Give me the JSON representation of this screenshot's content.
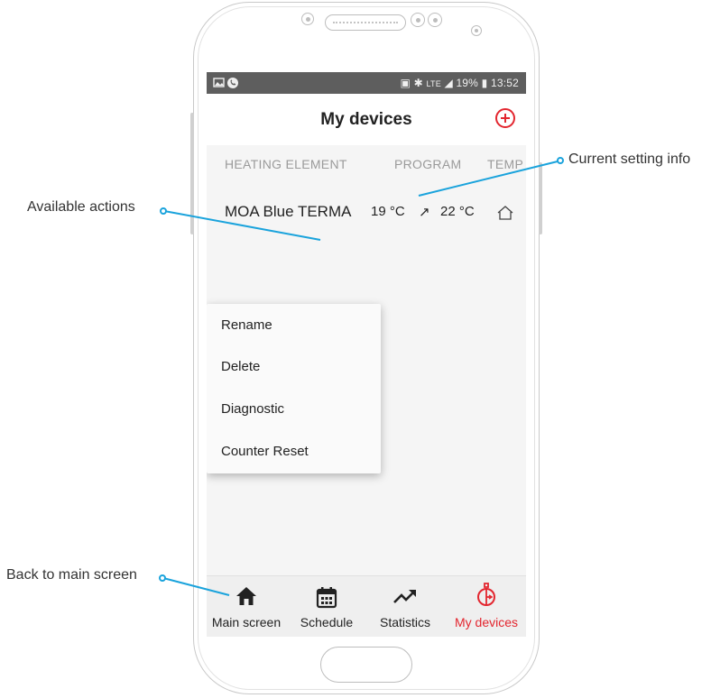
{
  "status_bar": {
    "left_icons": [
      "image-icon",
      "phone-icon"
    ],
    "network": "LTE",
    "battery": "19%",
    "time": "13:52"
  },
  "app_bar": {
    "title": "My devices",
    "add_icon": "plus-circle-icon"
  },
  "table": {
    "headers": [
      "HEATING ELEMENT",
      "PROGRAM",
      "TEMP"
    ],
    "device": {
      "name": "MOA Blue TERMA",
      "current_temp": "19 °C",
      "arrow": "↗",
      "target_temp": "22 °C",
      "mode_icon": "home-outline-icon"
    }
  },
  "context_menu": {
    "items": [
      "Rename",
      "Delete",
      "Diagnostic",
      "Counter Reset"
    ]
  },
  "bottom_nav": {
    "items": [
      {
        "label": "Main screen",
        "icon": "home-icon"
      },
      {
        "label": "Schedule",
        "icon": "calendar-icon"
      },
      {
        "label": "Statistics",
        "icon": "trend-up-icon"
      },
      {
        "label": "My devices",
        "icon": "radiator-icon"
      }
    ],
    "active_color": "#e3262f"
  },
  "annotations": {
    "current_setting": "Current setting info",
    "available_actions": "Available actions",
    "back_to_main": "Back to main screen",
    "line_color": "#1aa3dc"
  }
}
